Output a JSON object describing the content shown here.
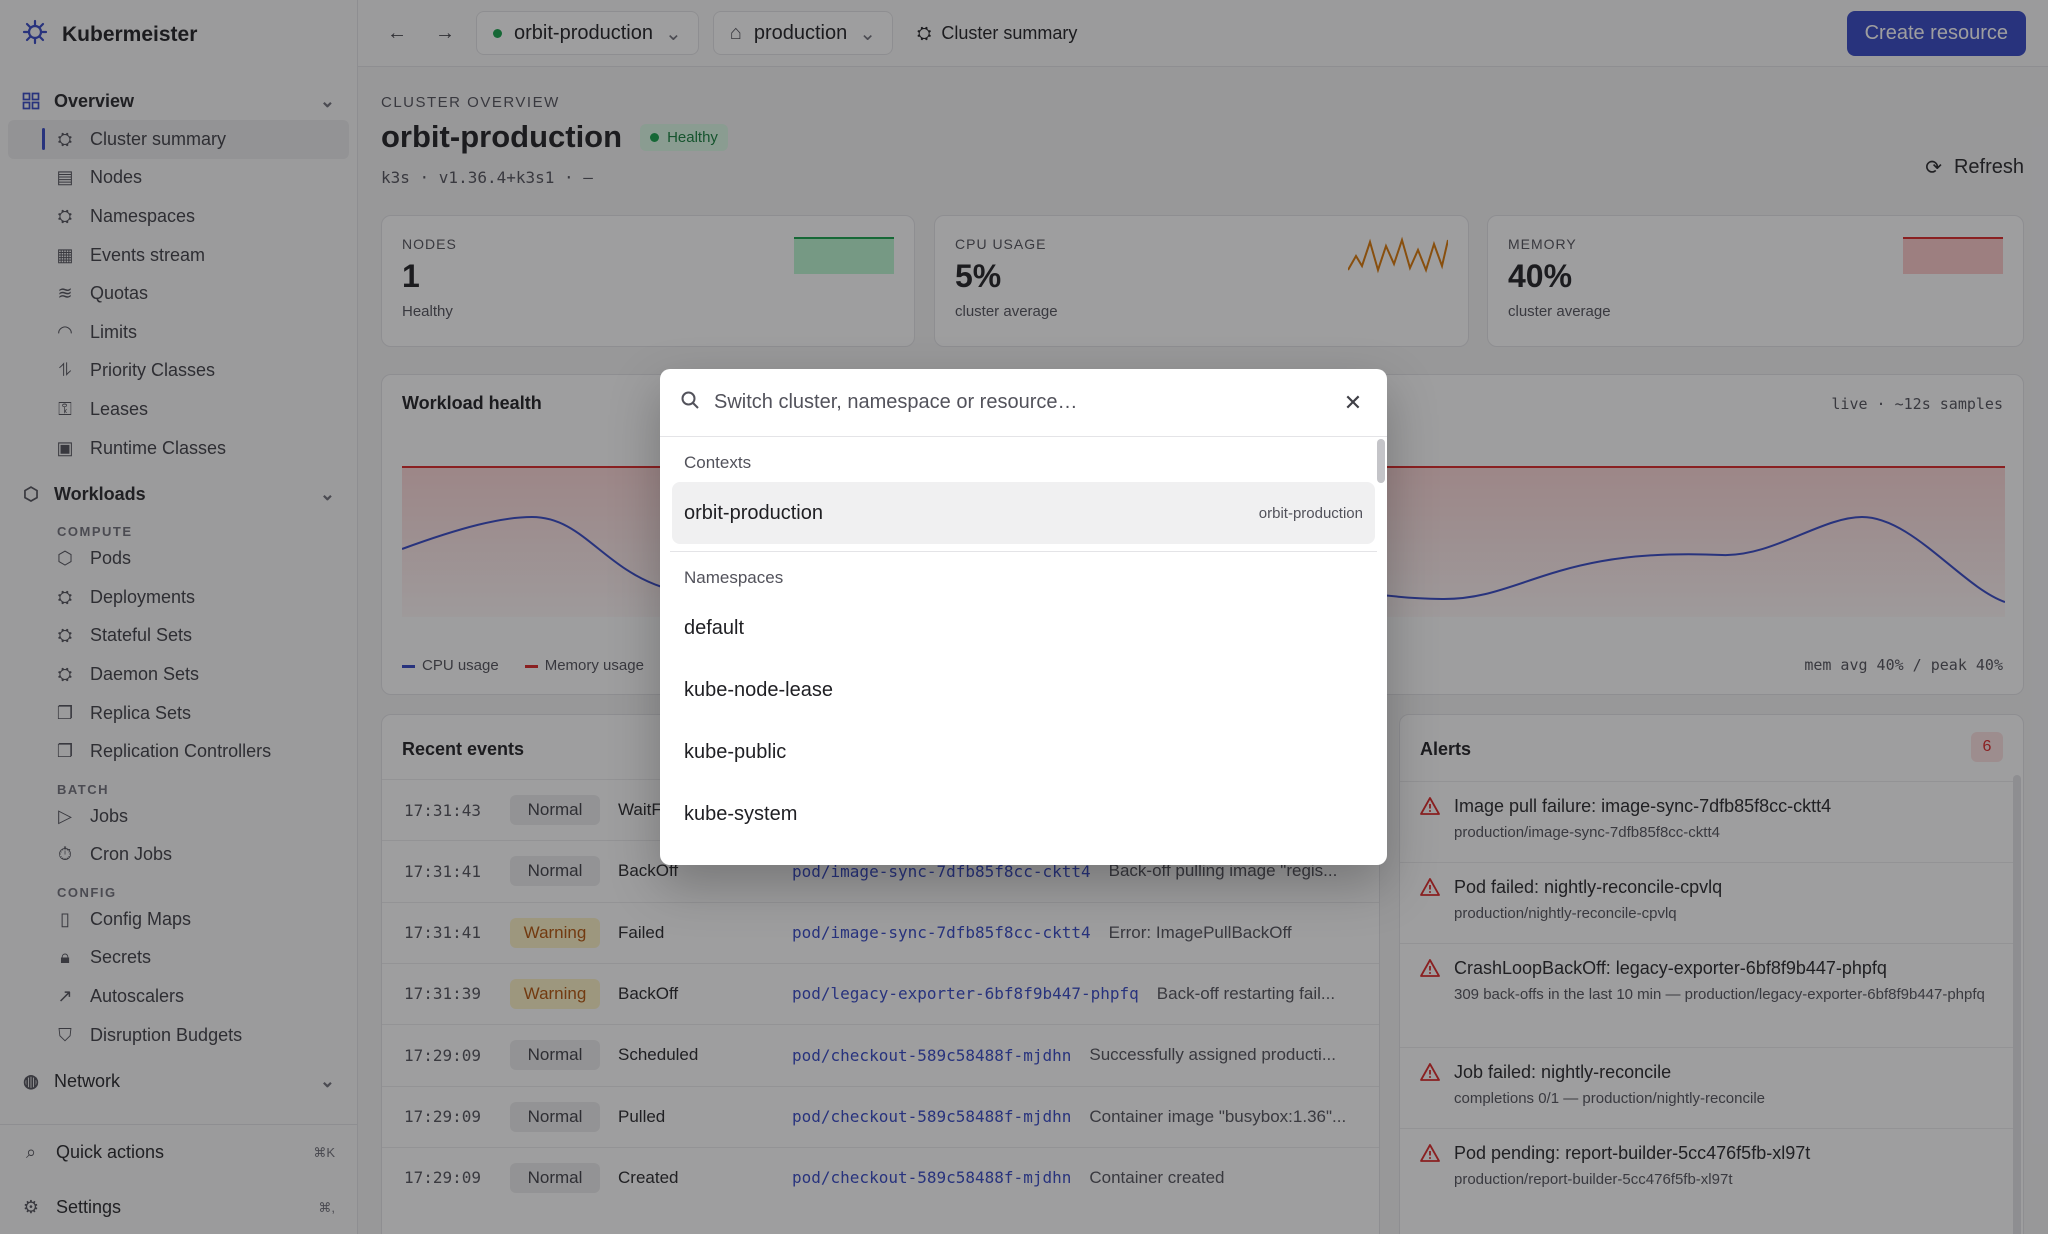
{
  "app": {
    "name": "Kubermeister"
  },
  "sidebar": {
    "groups": [
      {
        "label": "Overview",
        "items": [
          "Cluster summary",
          "Nodes",
          "Namespaces",
          "Events stream",
          "Quotas",
          "Limits",
          "Priority Classes",
          "Leases",
          "Runtime Classes"
        ]
      },
      {
        "label": "Workloads"
      }
    ],
    "workloads": {
      "compute_label": "COMPUTE",
      "compute": [
        "Pods",
        "Deployments",
        "Stateful Sets",
        "Daemon Sets",
        "Replica Sets",
        "Replication Controllers"
      ],
      "batch_label": "BATCH",
      "batch": [
        "Jobs",
        "Cron Jobs"
      ],
      "config_label": "CONFIG",
      "config": [
        "Config Maps",
        "Secrets",
        "Autoscalers",
        "Disruption Budgets"
      ]
    },
    "network_label": "Network",
    "footer": {
      "quick_actions": "Quick actions",
      "quick_actions_kbd": "⌘K",
      "settings": "Settings",
      "settings_kbd": "⌘,"
    }
  },
  "topbar": {
    "cluster": "orbit-production",
    "namespace": "production",
    "crumb": "Cluster summary",
    "create": "Create resource"
  },
  "header": {
    "kicker": "CLUSTER OVERVIEW",
    "title": "orbit-production",
    "status": "Healthy",
    "subline": "k3s · v1.36.4+k3s1 · —",
    "refresh": "Refresh"
  },
  "stats": [
    {
      "label": "NODES",
      "value": "1",
      "sub": "Healthy",
      "color": "#16a34a"
    },
    {
      "label": "CPU USAGE",
      "value": "5%",
      "sub": "cluster average",
      "color": "#d97706"
    },
    {
      "label": "MEMORY",
      "value": "40%",
      "sub": "cluster average",
      "color": "#dc2626"
    }
  ],
  "workload": {
    "title": "Workload health",
    "live": "live · ~12s samples",
    "legend_cpu": "CPU usage",
    "legend_mem": "Memory usage",
    "mem_avg": "mem avg 40% / peak 40%",
    "cpu_color": "#3447c4",
    "mem_color": "#dc2626"
  },
  "events": {
    "title": "Recent events",
    "rows": [
      {
        "time": "17:31:43",
        "type": "Normal",
        "reason": "WaitF",
        "object": "",
        "message": ""
      },
      {
        "time": "17:31:41",
        "type": "Normal",
        "reason": "BackOff",
        "object": "pod/image-sync-7dfb85f8cc-cktt4",
        "message": "Back-off pulling image \"regis..."
      },
      {
        "time": "17:31:41",
        "type": "Warning",
        "reason": "Failed",
        "object": "pod/image-sync-7dfb85f8cc-cktt4",
        "message": "Error: ImagePullBackOff"
      },
      {
        "time": "17:31:39",
        "type": "Warning",
        "reason": "BackOff",
        "object": "pod/legacy-exporter-6bf8f9b447-phpfq",
        "message": "Back-off restarting fail..."
      },
      {
        "time": "17:29:09",
        "type": "Normal",
        "reason": "Scheduled",
        "object": "pod/checkout-589c58488f-mjdhn",
        "message": "Successfully assigned producti..."
      },
      {
        "time": "17:29:09",
        "type": "Normal",
        "reason": "Pulled",
        "object": "pod/checkout-589c58488f-mjdhn",
        "message": "Container image \"busybox:1.36\"..."
      },
      {
        "time": "17:29:09",
        "type": "Normal",
        "reason": "Created",
        "object": "pod/checkout-589c58488f-mjdhn",
        "message": "Container created"
      }
    ]
  },
  "alerts": {
    "title": "Alerts",
    "count": "6",
    "rows": [
      {
        "title": "Image pull failure: image-sync-7dfb85f8cc-cktt4",
        "sub": "production/image-sync-7dfb85f8cc-cktt4"
      },
      {
        "title": "Pod failed: nightly-reconcile-cpvlq",
        "sub": "production/nightly-reconcile-cpvlq"
      },
      {
        "title": "CrashLoopBackOff: legacy-exporter-6bf8f9b447-phpfq",
        "sub": "309 back-offs in the last 10 min — production/legacy-exporter-6bf8f9b447-phpfq"
      },
      {
        "title": "Job failed: nightly-reconcile",
        "sub": "completions 0/1 — production/nightly-reconcile"
      },
      {
        "title": "Pod pending: report-builder-5cc476f5fb-xl97t",
        "sub": "production/report-builder-5cc476f5fb-xl97t"
      }
    ]
  },
  "palette": {
    "placeholder": "Switch cluster, namespace or resource…",
    "contexts_label": "Contexts",
    "contexts": [
      {
        "name": "orbit-production",
        "hint": "orbit-production"
      }
    ],
    "namespaces_label": "Namespaces",
    "namespaces": [
      "default",
      "kube-node-lease",
      "kube-public",
      "kube-system"
    ]
  }
}
